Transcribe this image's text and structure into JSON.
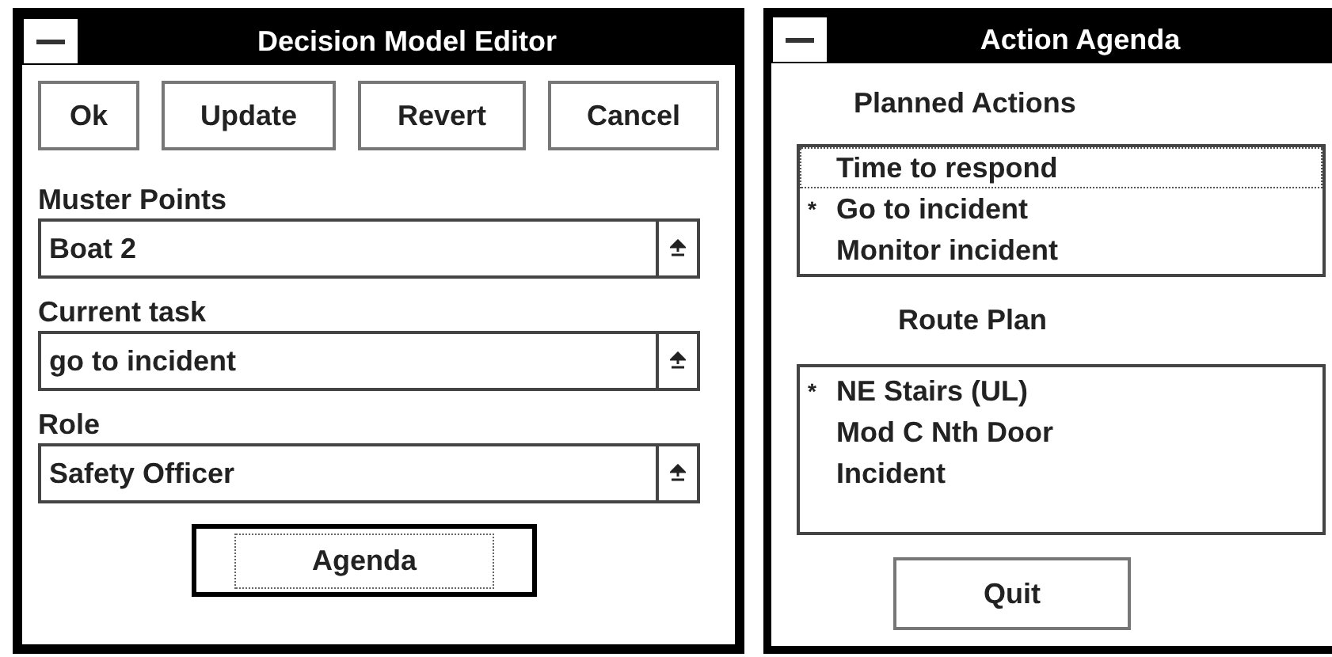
{
  "editor": {
    "title": "Decision Model Editor",
    "buttons": [
      {
        "label": "Ok",
        "default": false
      },
      {
        "label": "Update",
        "default": false
      },
      {
        "label": "Revert",
        "default": false
      },
      {
        "label": "Cancel",
        "default": false
      }
    ],
    "fields": [
      {
        "label": "Muster Points",
        "value": "Boat 2"
      },
      {
        "label": "Current task",
        "value": "go to incident"
      },
      {
        "label": "Role",
        "value": "Safety Officer"
      }
    ],
    "agenda_button": {
      "label": "Agenda",
      "default": true
    }
  },
  "agenda": {
    "title": "Action Agenda",
    "lists": [
      {
        "heading": "Planned Actions",
        "items": [
          {
            "text": "Time to respond",
            "focused": true
          },
          {
            "text": "Go to incident",
            "mark": "*",
            "focused": false
          },
          {
            "text": "Monitor incident",
            "focused": false
          }
        ]
      },
      {
        "heading": "Route Plan",
        "items": [
          {
            "text": "NE Stairs (UL)",
            "mark": "*",
            "focused": false
          },
          {
            "text": "Mod C Nth Door",
            "focused": false
          },
          {
            "text": "Incident",
            "focused": false
          }
        ]
      }
    ],
    "quit_button": {
      "label": "Quit",
      "default": false
    }
  }
}
